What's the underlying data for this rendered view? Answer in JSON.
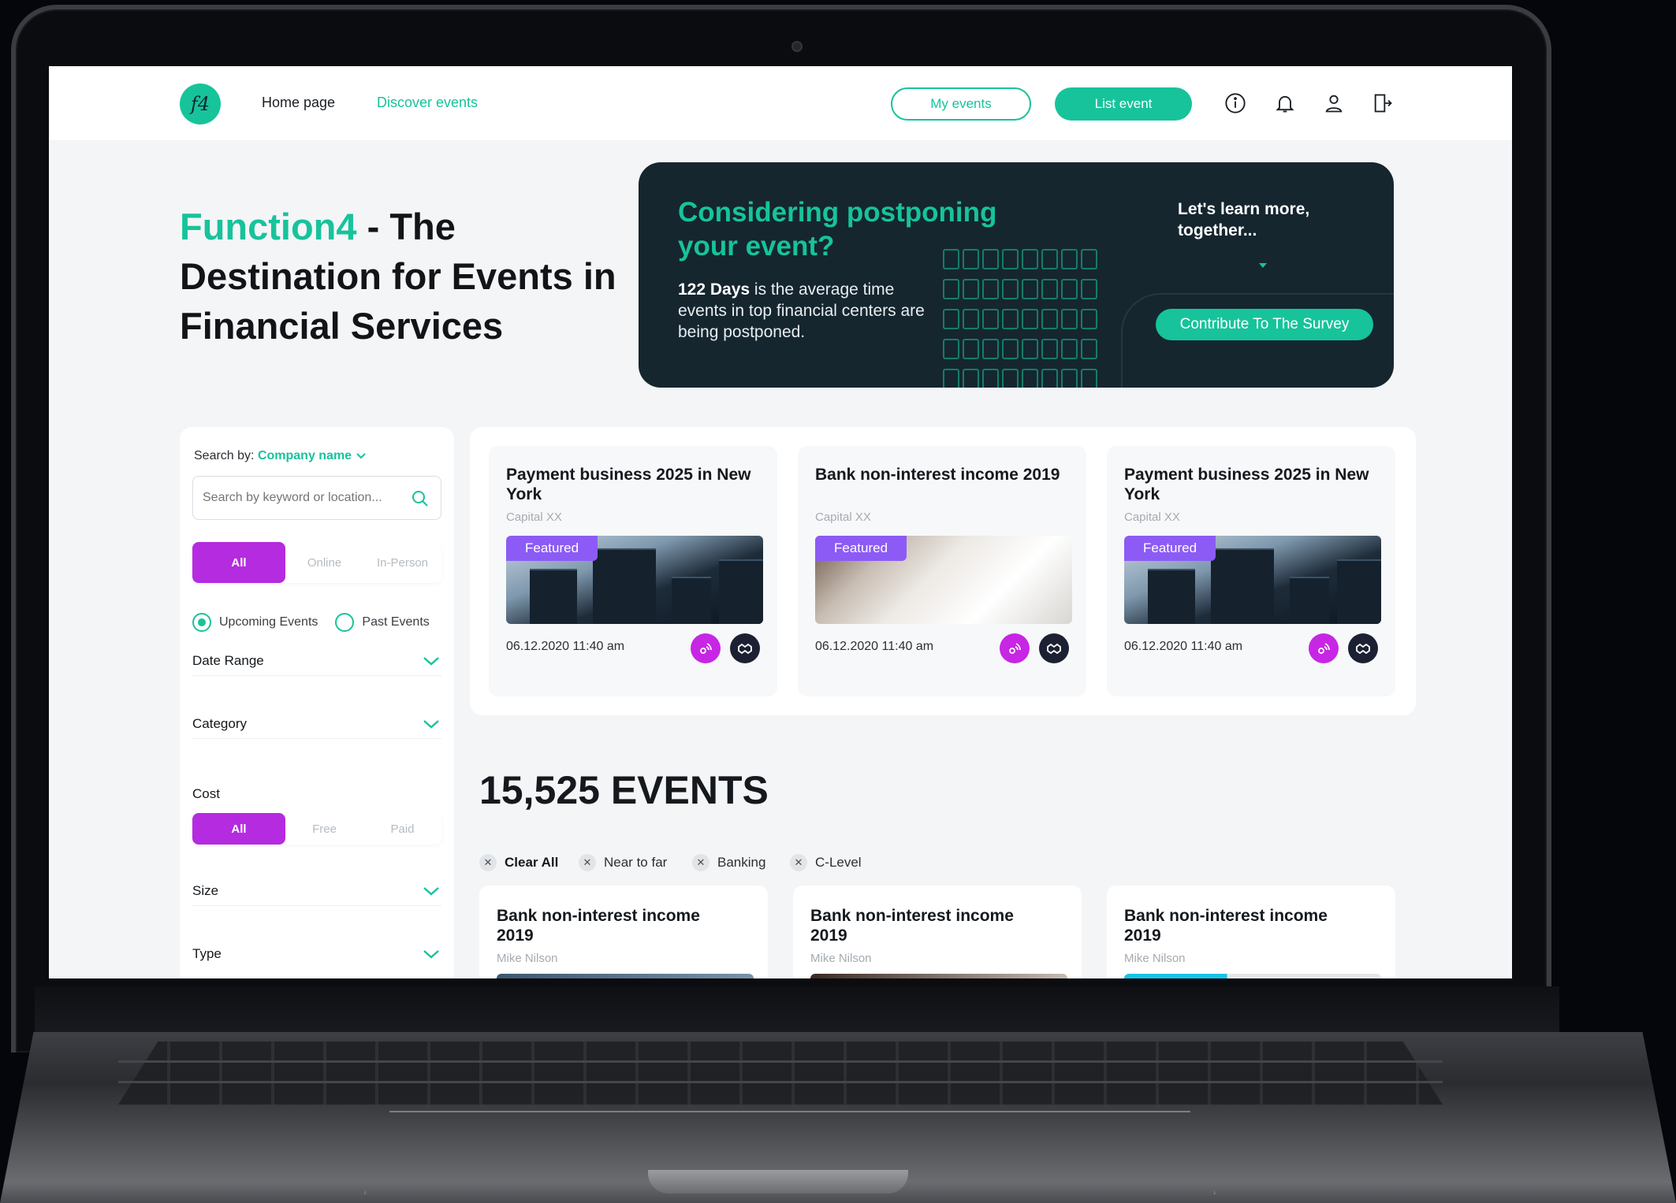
{
  "nav": {
    "logo_text": "f4",
    "links": [
      "Home page",
      "Discover events"
    ],
    "my_events": "My events",
    "list_event": "List event",
    "icons": [
      "info-icon",
      "bell-icon",
      "user-icon",
      "logout-icon"
    ]
  },
  "hero": {
    "brand": "Function4",
    "title_rest": " - The Destination for Events in Financial Services"
  },
  "promo": {
    "title": "Considering postponing your event?",
    "days": "122 Days",
    "text": " is the average time events in top financial centers are being postponed.",
    "right_title": "Let's learn more, together...",
    "button": "Contribute To The Survey"
  },
  "sidebar": {
    "search_by_label": "Search by:",
    "search_by_value": "Company name",
    "search_placeholder": "Search by keyword or location...",
    "format_options": [
      "All",
      "Online",
      "In-Person"
    ],
    "radios": [
      "Upcoming Events",
      "Past Events"
    ],
    "filters": [
      "Date Range",
      "Category",
      "Size",
      "Type"
    ],
    "cost_label": "Cost",
    "cost_options": [
      "All",
      "Free",
      "Paid"
    ]
  },
  "featured": [
    {
      "title": "Payment business 2025 in New York",
      "org": "Capital XX",
      "badge": "Featured",
      "date": "06.12.2020 11:40 am"
    },
    {
      "title": "Bank non-interest income 2019",
      "org": "Capital XX",
      "badge": "Featured",
      "date": "06.12.2020 11:40 am"
    },
    {
      "title": "Payment business 2025 in New York",
      "org": "Capital XX",
      "badge": "Featured",
      "date": "06.12.2020 11:40 am"
    }
  ],
  "events": {
    "count": "15,525 EVENTS",
    "chips": [
      "Clear All",
      "Near to far",
      "Banking",
      "C-Level"
    ],
    "cards": [
      {
        "title": "Bank non-interest income 2019",
        "org": "Mike Nilson"
      },
      {
        "title": "Bank non-interest income 2019",
        "org": "Mike Nilson"
      },
      {
        "title": "Bank non-interest income 2019",
        "org": "Mike Nilson"
      }
    ]
  },
  "colors": {
    "accent": "#17c39b",
    "purple": "#b52be0",
    "dark_panel": "#15262f"
  }
}
